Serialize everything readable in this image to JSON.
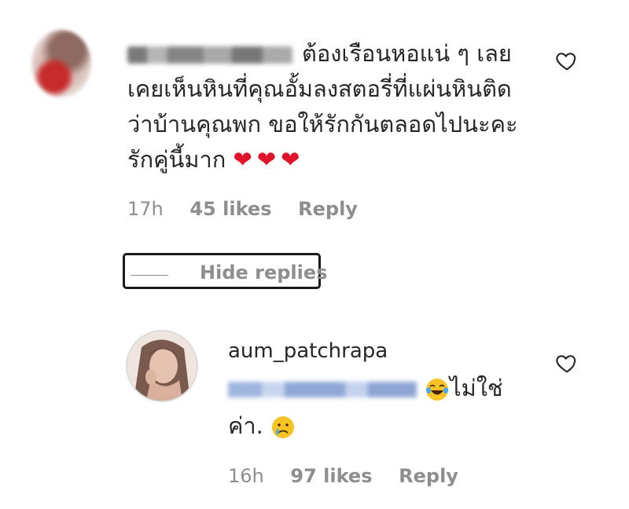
{
  "comment": {
    "text": "ต้องเรือนหอแน่ ๆ เลย เคยเห็นหินที่คุณอั้มลงสตอรี่ที่แผ่นหินติดว่าบ้านคุณพก ขอให้รักกันตลอดไปนะคะรักคู่นี้มาก",
    "hearts": "❤❤❤",
    "time": "17h",
    "likes": "45 likes",
    "reply_label": "Reply"
  },
  "hide_replies": {
    "label": "Hide replies"
  },
  "reply_comment": {
    "username": "aum_patchrapa",
    "text_part1": "ไม่ใช่",
    "text_part2": "ค่า.",
    "time": "16h",
    "likes": "97 likes",
    "reply_label": "Reply"
  },
  "icons": {
    "like": "heart-outline-icon",
    "laugh_emoji": "face-with-tears-of-joy-emoji",
    "sad_emoji": "crying-face-emoji"
  },
  "colors": {
    "text": "#262626",
    "muted": "#8e8e8e",
    "heart_red": "#e0132b"
  }
}
